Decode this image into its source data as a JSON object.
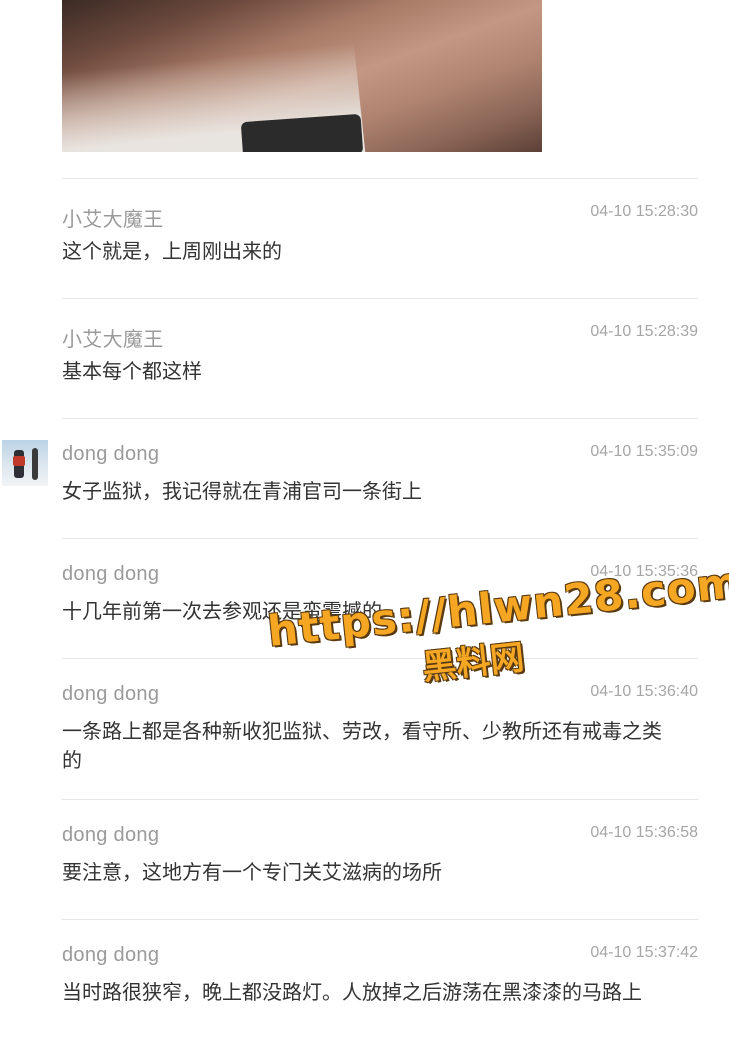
{
  "messages": [
    {
      "sender": "小艾大魔王",
      "time": "04-10 15:28:30",
      "text": "这个就是，上周刚出来的"
    },
    {
      "sender": "小艾大魔王",
      "time": "04-10 15:28:39",
      "text": "基本每个都这样"
    },
    {
      "sender": "dong dong",
      "time": "04-10 15:35:09",
      "text": "女子监狱，我记得就在青浦官司一条街上"
    },
    {
      "sender": "dong dong",
      "time": "04-10 15:35:36",
      "text": "十几年前第一次去参观还是蛮震撼的"
    },
    {
      "sender": "dong dong",
      "time": "04-10 15:36:40",
      "text": "一条路上都是各种新收犯监狱、劳改，看守所、少教所还有戒毒之类的"
    },
    {
      "sender": "dong dong",
      "time": "04-10 15:36:58",
      "text": "要注意，这地方有一个专门关艾滋病的场所"
    },
    {
      "sender": "dong dong",
      "time": "04-10 15:37:42",
      "text": "当时路很狭窄，晚上都没路灯。人放掉之后游荡在黑漆漆的马路上"
    }
  ],
  "watermark": {
    "url": "https://hlwn28.com",
    "name": "黑料网"
  },
  "icons": {
    "avatar": "avatar-snowboarder-icon",
    "photo": "photo-image"
  }
}
